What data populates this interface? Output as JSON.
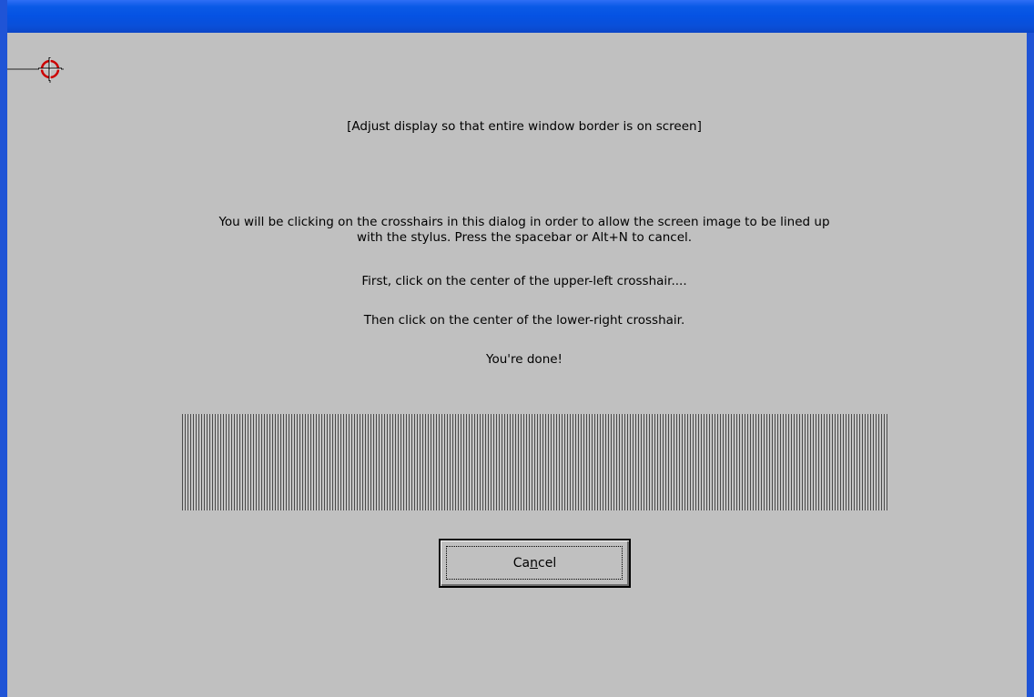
{
  "dialog": {
    "adjust_note": "[Adjust display so that entire window border is on screen]",
    "instructions_line1": "You will be clicking on the crosshairs in this dialog in order to allow the screen image to be lined up",
    "instructions_line2": "with the stylus. Press the spacebar or Alt+N to cancel.",
    "step_first": "First, click on the center of the upper-left crosshair....",
    "step_then": "Then click on the center of the lower-right crosshair.",
    "step_done": "You're done!",
    "cancel_button": {
      "label_before": "Ca",
      "label_mnemonic": "n",
      "label_after": "cel"
    }
  },
  "icons": {
    "crosshair": "crosshair-target-icon"
  },
  "colors": {
    "window_border": "#1f54d6",
    "title_bar": "#0552e3",
    "dialog_background": "#c0c0c0",
    "crosshair_accent": "#cc0000"
  }
}
